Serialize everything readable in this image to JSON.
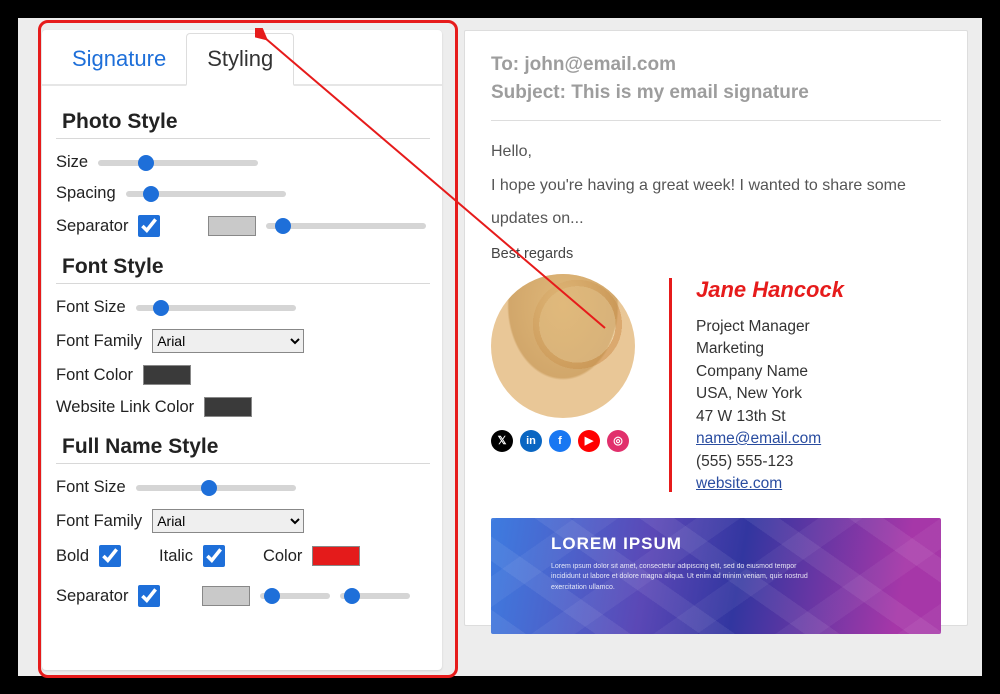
{
  "tabs": {
    "signature": "Signature",
    "styling": "Styling"
  },
  "photo": {
    "heading": "Photo Style",
    "size_label": "Size",
    "spacing_label": "Spacing",
    "separator_label": "Separator",
    "separator_checked": true
  },
  "font": {
    "heading": "Font Style",
    "size_label": "Font Size",
    "family_label": "Font Family",
    "family_value": "Arial",
    "color_label": "Font Color",
    "link_color_label": "Website Link Color"
  },
  "fullname": {
    "heading": "Full Name Style",
    "size_label": "Font Size",
    "family_label": "Font Family",
    "family_value": "Arial",
    "bold_label": "Bold",
    "bold_checked": true,
    "italic_label": "Italic",
    "italic_checked": true,
    "color_label": "Color",
    "separator_label": "Separator",
    "separator_checked": true
  },
  "preview": {
    "to_label": "To: john@email.com",
    "subject_label": "Subject: This is my email signature",
    "greeting": "Hello,",
    "body": "I hope you're having a great week! I wanted to share some updates on...",
    "regards": "Best regards",
    "signature": {
      "name": "Jane Hancock",
      "title": "Project Manager",
      "dept": "Marketing",
      "company": "Company Name",
      "location": "USA, New York",
      "address": "47 W 13th St",
      "email": "name@email.com",
      "phone": "(555) 555-123",
      "website": "website.com"
    },
    "banner": {
      "title": "LOREM IPSUM",
      "text": "Lorem ipsum dolor sit amet, consectetur adipiscing elit, sed do eiusmod tempor incididunt ut labore et dolore magna aliqua. Ut enim ad minim veniam, quis nostrud exercitation ullamco."
    }
  }
}
